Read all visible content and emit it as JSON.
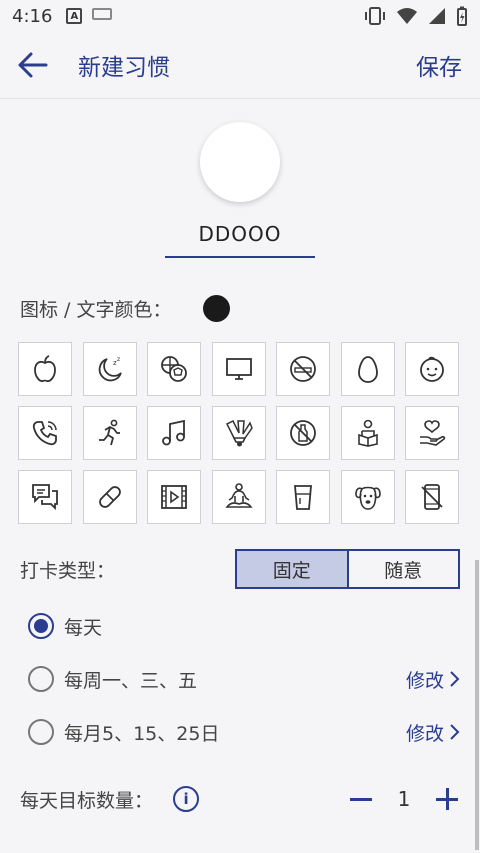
{
  "status_bar": {
    "time": "4:16",
    "left_icons": [
      "a-notification-icon",
      "keyboard-icon"
    ],
    "right_icons": [
      "vibrate-icon",
      "wifi-icon",
      "signal-icon",
      "battery-icon"
    ]
  },
  "appbar": {
    "title": "新建习惯",
    "save_label": "保存"
  },
  "habit_name": "DDOOO",
  "color": {
    "label": "图标 / 文字颜色：",
    "value": "#1a1a1a"
  },
  "icons": [
    "apple-icon",
    "moon-sleep-icon",
    "balls-icon",
    "monitor-icon",
    "no-smoking-icon",
    "egg-icon",
    "baby-face-icon",
    "phone-icon",
    "running-icon",
    "music-icon",
    "badminton-icon",
    "no-drinking-icon",
    "reading-icon",
    "heart-hand-icon",
    "chat-icon",
    "pill-icon",
    "video-icon",
    "meditation-icon",
    "cup-icon",
    "dog-icon",
    "no-phone-icon"
  ],
  "checkin": {
    "label": "打卡类型：",
    "options": [
      "固定",
      "随意"
    ],
    "selected": "固定"
  },
  "schedule": [
    {
      "label": "每天",
      "selected": true
    },
    {
      "label": "每周一、三、五",
      "selected": false,
      "action": "修改"
    },
    {
      "label": "每月5、15、25日",
      "selected": false,
      "action": "修改"
    }
  ],
  "target": {
    "label": "每天目标数量：",
    "info": "i",
    "value": "1"
  },
  "colors": {
    "accent": "#2a3d8f",
    "segment_on": "#c5cbe4",
    "background": "#f5f5f7"
  }
}
